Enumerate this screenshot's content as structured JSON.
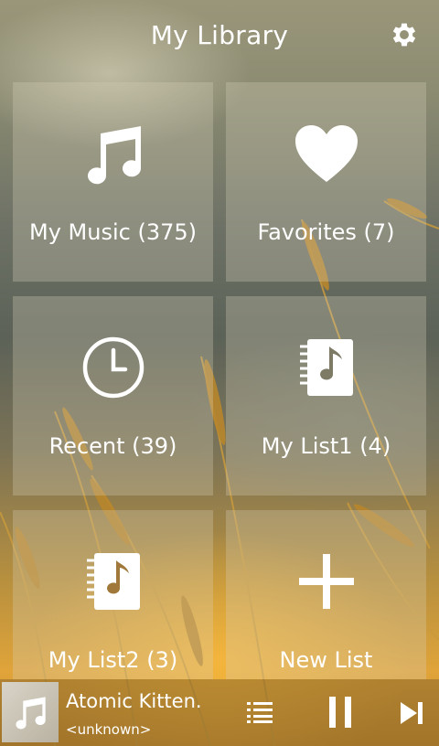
{
  "header": {
    "title": "My Library",
    "settings_icon": "gear-icon"
  },
  "tiles": [
    {
      "label": "My Music (375)",
      "icon": "music-note-icon"
    },
    {
      "label": "Favorites (7)",
      "icon": "heart-icon"
    },
    {
      "label": "Recent (39)",
      "icon": "clock-icon"
    },
    {
      "label": "My List1 (4)",
      "icon": "playlist-notebook-icon"
    },
    {
      "label": "My List2 (3)",
      "icon": "playlist-notebook-icon"
    },
    {
      "label": "New List",
      "icon": "plus-icon"
    }
  ],
  "player": {
    "song": "Atomic Kitten.",
    "artist": "<unknown>",
    "album_art_icon": "music-note-icon",
    "queue_icon": "queue-list-icon",
    "pause_icon": "pause-icon",
    "next_icon": "skip-next-icon"
  },
  "colors": {
    "text": "#ffffff",
    "tile_overlay": "rgba(215,210,185,0.30)"
  }
}
